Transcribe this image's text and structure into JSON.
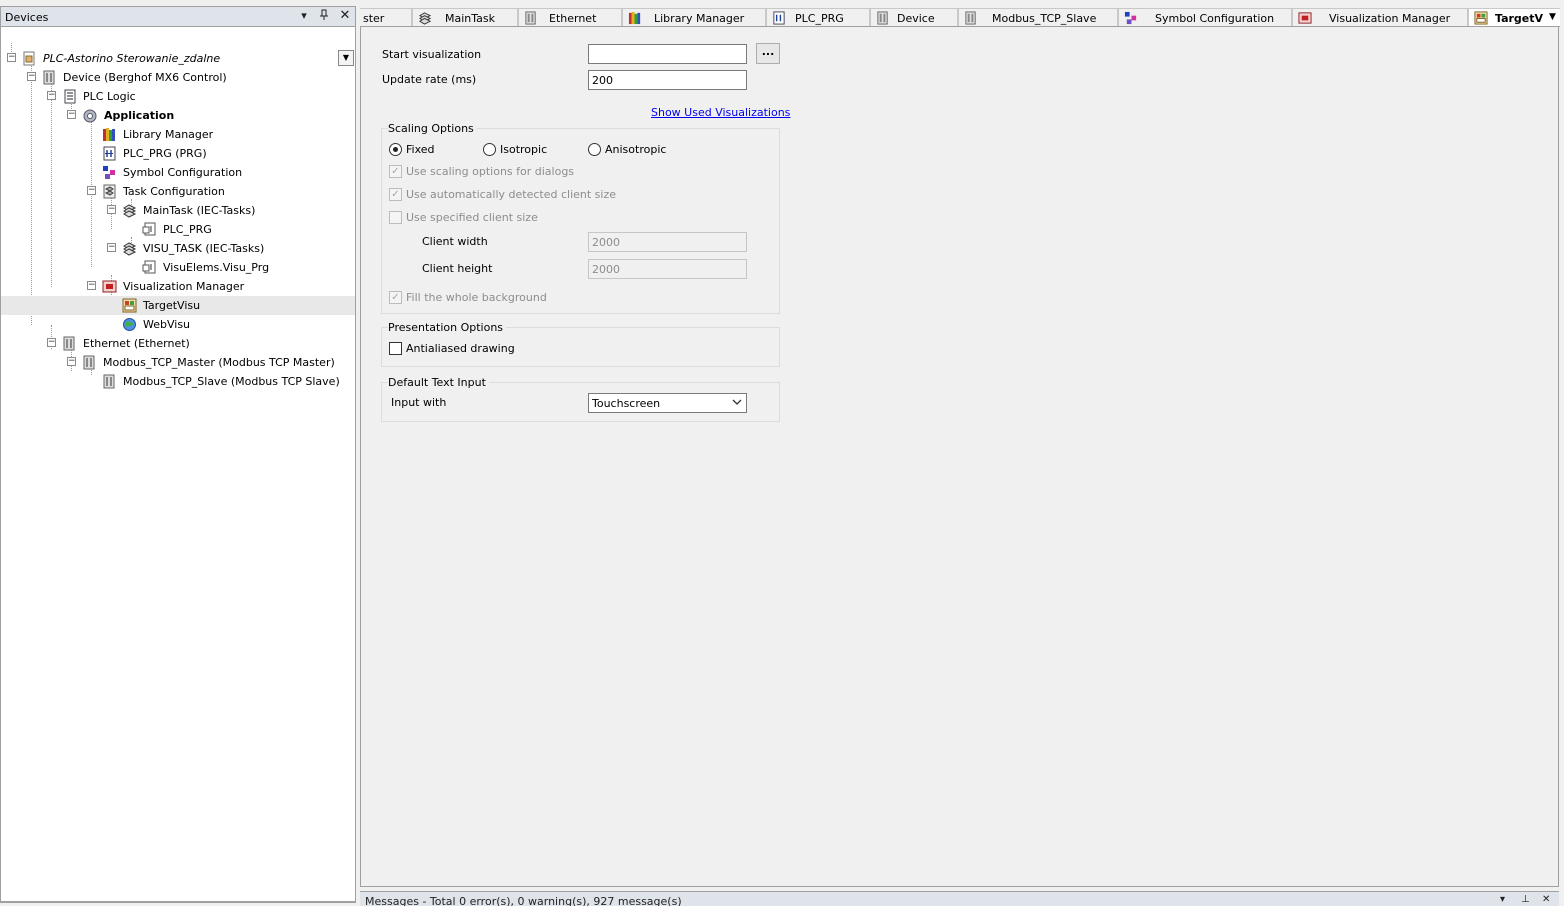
{
  "devices_panel": {
    "title": "Devices",
    "dropdown_icon": "chevron-down-icon",
    "pin_icon": "pin-icon",
    "close_icon": "close-icon",
    "tree": [
      {
        "label": "PLC-Astorino Sterowanie_zdalne",
        "icon": "project-icon"
      },
      {
        "label": "Device (Berghof MX6 Control)",
        "icon": "device-icon"
      },
      {
        "label": "PLC Logic",
        "icon": "plc-logic-icon"
      },
      {
        "label": "Application",
        "icon": "application-gear-icon"
      },
      {
        "label": "Library Manager",
        "icon": "library-manager-icon"
      },
      {
        "label": "PLC_PRG (PRG)",
        "icon": "program-icon"
      },
      {
        "label": "Symbol Configuration",
        "icon": "symbol-configuration-icon"
      },
      {
        "label": "Task Configuration",
        "icon": "task-configuration-icon"
      },
      {
        "label": "MainTask (IEC-Tasks)",
        "icon": "task-icon"
      },
      {
        "label": "PLC_PRG",
        "icon": "program-call-icon"
      },
      {
        "label": "VISU_TASK (IEC-Tasks)",
        "icon": "task-icon"
      },
      {
        "label": "VisuElems.Visu_Prg",
        "icon": "program-call-icon"
      },
      {
        "label": "Visualization Manager",
        "icon": "visualization-manager-icon"
      },
      {
        "label": "TargetVisu",
        "icon": "target-visu-icon"
      },
      {
        "label": "WebVisu",
        "icon": "web-visu-icon"
      },
      {
        "label": "Ethernet (Ethernet)",
        "icon": "ethernet-icon"
      },
      {
        "label": "Modbus_TCP_Master (Modbus TCP Master)",
        "icon": "modbus-master-icon"
      },
      {
        "label": "Modbus_TCP_Slave (Modbus TCP Slave)",
        "icon": "modbus-slave-icon"
      }
    ]
  },
  "tabs": [
    {
      "label": "ster"
    },
    {
      "label": "MainTask"
    },
    {
      "label": "Ethernet"
    },
    {
      "label": "Library Manager"
    },
    {
      "label": "PLC_PRG"
    },
    {
      "label": "Device"
    },
    {
      "label": "Modbus_TCP_Slave"
    },
    {
      "label": "Symbol Configuration"
    },
    {
      "label": "Visualization Manager"
    },
    {
      "label": "TargetV"
    }
  ],
  "editor": {
    "start_visualization_label": "Start visualization",
    "start_visualization_value": "",
    "browse_label": "...",
    "update_rate_label": "Update rate (ms)",
    "update_rate_value": "200",
    "show_used_link": "Show Used Visualizations",
    "scaling": {
      "title": "Scaling Options",
      "fixed": "Fixed",
      "isotropic": "Isotropic",
      "anisotropic": "Anisotropic",
      "selected": "Fixed",
      "use_scaling_dialogs": "Use scaling options for dialogs",
      "use_auto_client_size": "Use automatically detected client size",
      "use_specified_client_size": "Use specified client size",
      "client_width_label": "Client width",
      "client_width_value": "2000",
      "client_height_label": "Client height",
      "client_height_value": "2000",
      "fill_background": "Fill the whole background"
    },
    "presentation": {
      "title": "Presentation Options",
      "antialiased": "Antialiased drawing"
    },
    "text_input": {
      "title": "Default Text Input",
      "input_with_label": "Input with",
      "input_with_value": "Touchscreen"
    }
  },
  "messages": {
    "text": "Messages - Total 0 error(s), 0 warning(s), 927 message(s)"
  }
}
